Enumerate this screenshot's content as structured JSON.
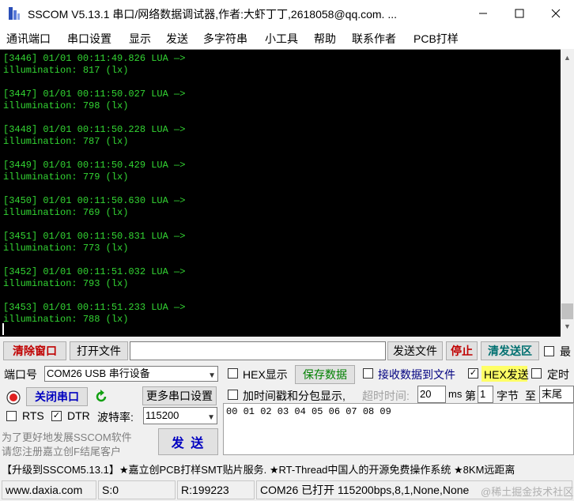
{
  "window": {
    "title": "SSCOM V5.13.1 串口/网络数据调试器,作者:大虾丁丁,2618058@qq.com. ...",
    "minimize_glyph": "—",
    "maximize_glyph": "☐",
    "close_glyph": "✕"
  },
  "menu": [
    "通讯端口",
    "串口设置",
    "显示",
    "发送",
    "多字符串",
    "小工具",
    "帮助",
    "联系作者",
    "PCB打样"
  ],
  "terminal": {
    "text_color": "#33d633",
    "entries": [
      {
        "header": "[3446] 01/01 00:11:49.826 LUA —>",
        "body": "illumination: 817 (lx)"
      },
      {
        "header": "[3447] 01/01 00:11:50.027 LUA —>",
        "body": "illumination: 798 (lx)"
      },
      {
        "header": "[3448] 01/01 00:11:50.228 LUA —>",
        "body": "illumination: 787 (lx)"
      },
      {
        "header": "[3449] 01/01 00:11:50.429 LUA —>",
        "body": "illumination: 779 (lx)"
      },
      {
        "header": "[3450] 01/01 00:11:50.630 LUA —>",
        "body": "illumination: 769 (lx)"
      },
      {
        "header": "[3451] 01/01 00:11:50.831 LUA —>",
        "body": "illumination: 773 (lx)"
      },
      {
        "header": "[3452] 01/01 00:11:51.032 LUA —>",
        "body": "illumination: 793 (lx)"
      },
      {
        "header": "[3453] 01/01 00:11:51.233 LUA —>",
        "body": "illumination: 788 (lx)"
      }
    ]
  },
  "toolbar": {
    "clear_window": "清除窗口",
    "open_file": "打开文件",
    "send_file": "发送文件",
    "stop": "停止",
    "clear_send": "清发送区",
    "most_front_partial": "最"
  },
  "port": {
    "label": "端口号",
    "value": "COM26 USB 串行设备",
    "close_button": "关闭串口",
    "more_settings": "更多串口设置",
    "rts_label": "RTS",
    "rts_checked": false,
    "dtr_label": "DTR",
    "dtr_checked": true,
    "baud_label": "波特率:",
    "baud_value": "115200"
  },
  "options": {
    "hex_display": "HEX显示",
    "hex_display_checked": false,
    "save_data": "保存数据",
    "receive_to_file": "接收数据到文件",
    "receive_to_file_checked": false,
    "hex_send": "HEX发送",
    "hex_send_checked": true,
    "timed_send_partial": "定时",
    "timed_send_checked": false,
    "timestamp": "加时间戳和分包显示,",
    "timestamp_checked": false,
    "timeout_label": "超时时间:",
    "timeout_value": "20",
    "timeout_unit": "ms",
    "page_label": "第",
    "page_value": "1",
    "byte_label": "字节",
    "to_label": "至",
    "end_value": "末尾"
  },
  "send": {
    "content": "00 01 02 03 04 05 06 07 08 09",
    "button": "发 送",
    "promo_line1": "为了更好地发展SSCOM软件",
    "promo_line2": "请您注册嘉立创F结尾客户"
  },
  "ticker": "【升级到SSCOM5.13.1】★嘉立创PCB打样SMT贴片服务. ★RT-Thread中国人的开源免费操作系统 ★8KM远距离",
  "status": {
    "url": "www.daxia.com",
    "sent": "S:0",
    "received": "R:199223",
    "port_state": "COM26 已打开  115200bps,8,1,None,None",
    "watermark": "@稀土掘金技术社区"
  }
}
